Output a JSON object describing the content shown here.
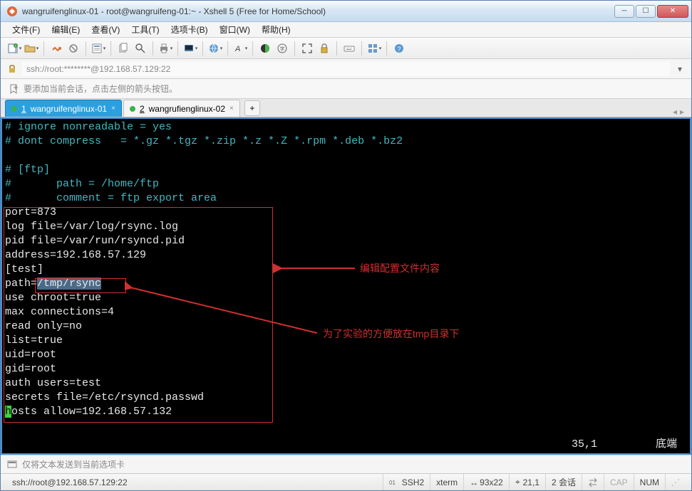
{
  "titlebar": {
    "title": "wangruifenglinux-01 - root@wangruifeng-01:~ - Xshell 5 (Free for Home/School)"
  },
  "menubar": {
    "items": [
      {
        "label": "文件(F)"
      },
      {
        "label": "编辑(E)"
      },
      {
        "label": "查看(V)"
      },
      {
        "label": "工具(T)"
      },
      {
        "label": "选项卡(B)"
      },
      {
        "label": "窗口(W)"
      },
      {
        "label": "帮助(H)"
      }
    ]
  },
  "addrbar": {
    "text": "ssh://root:********@192.168.57.129:22"
  },
  "hintbar": {
    "text": "要添加当前会话，点击左侧的箭头按钮。"
  },
  "tabs": {
    "items": [
      {
        "index": "1",
        "label": "wangruifenglinux-01",
        "active": true
      },
      {
        "index": "2",
        "label": "wangrufienglinux-02",
        "active": false
      }
    ],
    "add": "+"
  },
  "terminal": {
    "comments": [
      "# ignore nonreadable = yes",
      "# dont compress   = *.gz *.tgz *.zip *.z *.Z *.rpm *.deb *.bz2",
      "",
      "# [ftp]",
      "#       path = /home/ftp",
      "#       comment = ftp export area"
    ],
    "config": [
      {
        "k": "port=",
        "v": "873"
      },
      {
        "k": "log file=",
        "v": "/var/log/rsync.log"
      },
      {
        "k": "pid file=",
        "v": "/var/run/rsyncd.pid"
      },
      {
        "k": "address=",
        "v": "192.168.57.129"
      },
      {
        "k": "",
        "v": "[test]"
      },
      {
        "k": "path=",
        "v": "/tmp/rsync",
        "hl": true
      },
      {
        "k": "use chroot=",
        "v": "true"
      },
      {
        "k": "max connections=",
        "v": "4"
      },
      {
        "k": "read only=",
        "v": "no"
      },
      {
        "k": "list=",
        "v": "true"
      },
      {
        "k": "uid=",
        "v": "root"
      },
      {
        "k": "gid=",
        "v": "root"
      },
      {
        "k": "auth users=",
        "v": "test"
      },
      {
        "k": "secrets file=",
        "v": "/etc/rsyncd.passwd"
      },
      {
        "k": "osts allow=",
        "v": "192.168.57.132",
        "cursor_prefix": "h"
      }
    ],
    "annot1": "编辑配置文件内容",
    "annot2": "为了实验的方便放在tmp目录下",
    "pos": "35,1",
    "posmode": "底端"
  },
  "sendbar": {
    "text": "仅将文本发送到当前选项卡"
  },
  "statusbar": {
    "conn": "ssh://root@192.168.57.129:22",
    "ssh": "SSH2",
    "termtype": "xterm",
    "size": "93x22",
    "caret": "21,1",
    "sessions": "2 会话",
    "caps": "CAP",
    "num": "NUM"
  },
  "icons": {
    "lock": "lock-icon",
    "hint": "arrow-right-icon"
  }
}
